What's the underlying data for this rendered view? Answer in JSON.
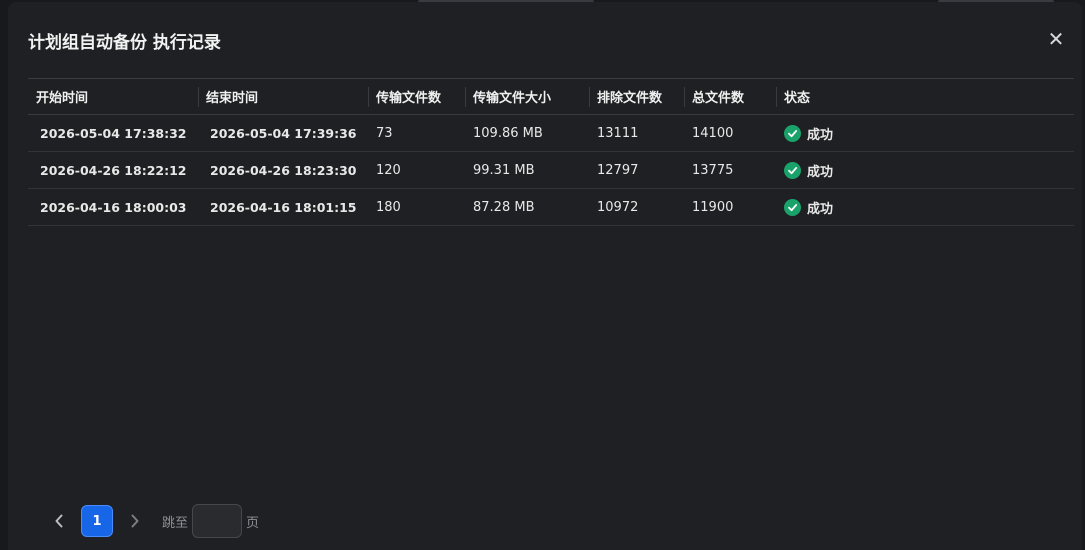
{
  "modal": {
    "title": "计划组自动备份 执行记录",
    "close_icon": "close-icon"
  },
  "table": {
    "columns": [
      "开始时间",
      "结束时间",
      "传输文件数",
      "传输文件大小",
      "排除文件数",
      "总文件数",
      "状态"
    ],
    "rows": [
      {
        "start": "2026-05-04 17:38:32",
        "end": "2026-05-04 17:39:36",
        "transferred": "73",
        "size": "109.86 MB",
        "excluded": "13111",
        "total": "14100",
        "status": "成功"
      },
      {
        "start": "2026-04-26 18:22:12",
        "end": "2026-04-26 18:23:30",
        "transferred": "120",
        "size": "99.31 MB",
        "excluded": "12797",
        "total": "13775",
        "status": "成功"
      },
      {
        "start": "2026-04-16 18:00:03",
        "end": "2026-04-16 18:01:15",
        "transferred": "180",
        "size": "87.28 MB",
        "excluded": "10972",
        "total": "11900",
        "status": "成功"
      }
    ],
    "status_color": "#19a36b"
  },
  "pagination": {
    "current_page": "1",
    "jump_label": "跳至",
    "jump_value": "",
    "page_label": "页",
    "accent": "#1766e8"
  }
}
